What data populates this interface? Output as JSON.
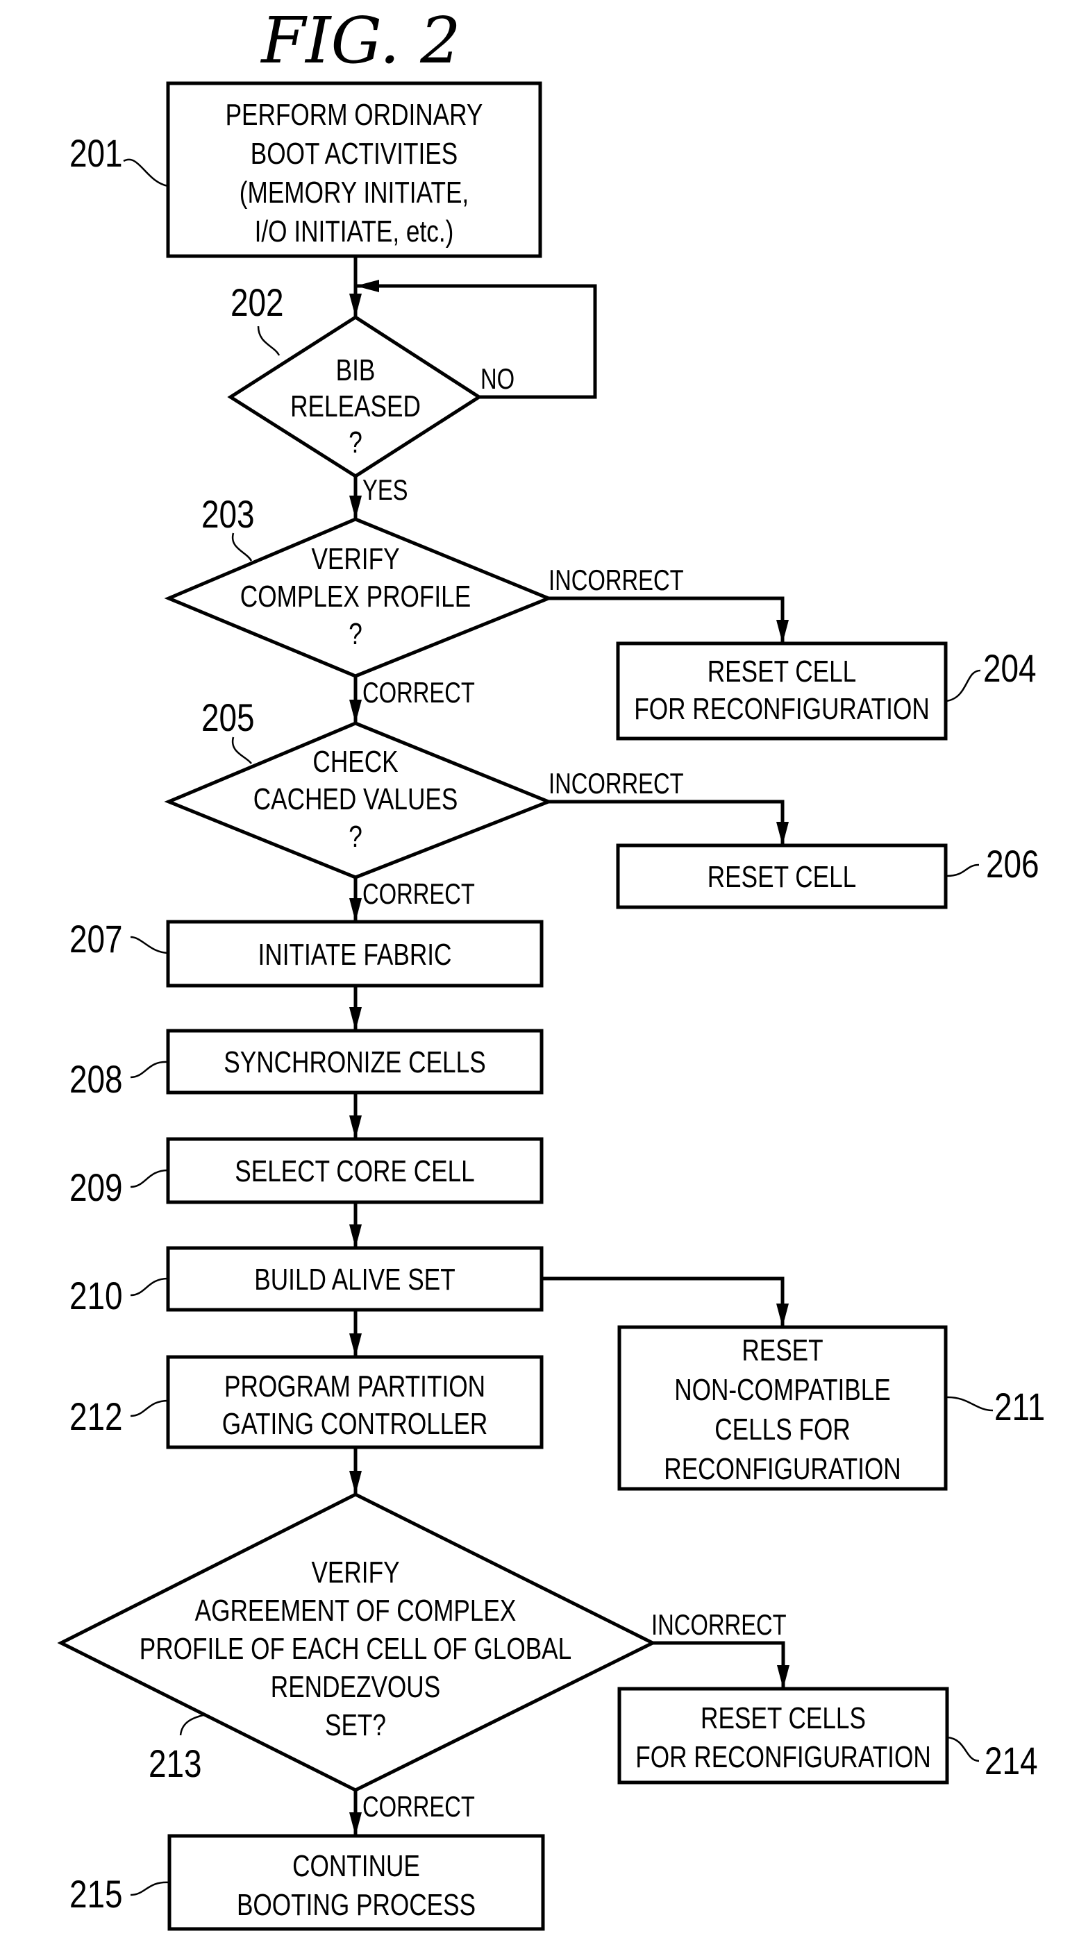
{
  "figure": {
    "title": "FIG. 2",
    "nodes": [
      {
        "id": "201",
        "type": "process",
        "lines": [
          "PERFORM ORDINARY",
          "BOOT ACTIVITIES",
          "(MEMORY INITIATE,",
          "I/O INITIATE, etc.)"
        ]
      },
      {
        "id": "202",
        "type": "decision",
        "lines": [
          "BIB",
          "RELEASED",
          "?"
        ]
      },
      {
        "id": "203",
        "type": "decision",
        "lines": [
          "VERIFY",
          "COMPLEX PROFILE",
          "?"
        ]
      },
      {
        "id": "204",
        "type": "process",
        "lines": [
          "RESET CELL",
          "FOR RECONFIGURATION"
        ]
      },
      {
        "id": "205",
        "type": "decision",
        "lines": [
          "CHECK",
          "CACHED VALUES",
          "?"
        ]
      },
      {
        "id": "206",
        "type": "process",
        "lines": [
          "RESET CELL"
        ]
      },
      {
        "id": "207",
        "type": "process",
        "lines": [
          "INITIATE FABRIC"
        ]
      },
      {
        "id": "208",
        "type": "process",
        "lines": [
          "SYNCHRONIZE CELLS"
        ]
      },
      {
        "id": "209",
        "type": "process",
        "lines": [
          "SELECT CORE CELL"
        ]
      },
      {
        "id": "210",
        "type": "process",
        "lines": [
          "BUILD ALIVE SET"
        ]
      },
      {
        "id": "211",
        "type": "process",
        "lines": [
          "RESET",
          "NON-COMPATIBLE",
          "CELLS FOR",
          "RECONFIGURATION"
        ]
      },
      {
        "id": "212",
        "type": "process",
        "lines": [
          "PROGRAM PARTITION",
          "GATING CONTROLLER"
        ]
      },
      {
        "id": "213",
        "type": "decision",
        "lines": [
          "VERIFY",
          "AGREEMENT OF COMPLEX",
          "PROFILE OF EACH CELL OF GLOBAL",
          "RENDEZVOUS",
          "SET?"
        ]
      },
      {
        "id": "214",
        "type": "process",
        "lines": [
          "RESET CELLS",
          "FOR RECONFIGURATION"
        ]
      },
      {
        "id": "215",
        "type": "process",
        "lines": [
          "CONTINUE",
          "BOOTING PROCESS"
        ]
      }
    ],
    "edges": [
      {
        "from": "201",
        "to": "202",
        "label": ""
      },
      {
        "from": "202",
        "to": "202",
        "label": "NO"
      },
      {
        "from": "202",
        "to": "203",
        "label": "YES"
      },
      {
        "from": "203",
        "to": "204",
        "label": "INCORRECT"
      },
      {
        "from": "203",
        "to": "205",
        "label": "CORRECT"
      },
      {
        "from": "205",
        "to": "206",
        "label": "INCORRECT"
      },
      {
        "from": "205",
        "to": "207",
        "label": "CORRECT"
      },
      {
        "from": "207",
        "to": "208",
        "label": ""
      },
      {
        "from": "208",
        "to": "209",
        "label": ""
      },
      {
        "from": "209",
        "to": "210",
        "label": ""
      },
      {
        "from": "210",
        "to": "211",
        "label": ""
      },
      {
        "from": "210",
        "to": "212",
        "label": ""
      },
      {
        "from": "212",
        "to": "213",
        "label": ""
      },
      {
        "from": "213",
        "to": "214",
        "label": "INCORRECT"
      },
      {
        "from": "213",
        "to": "215",
        "label": "CORRECT"
      }
    ]
  }
}
